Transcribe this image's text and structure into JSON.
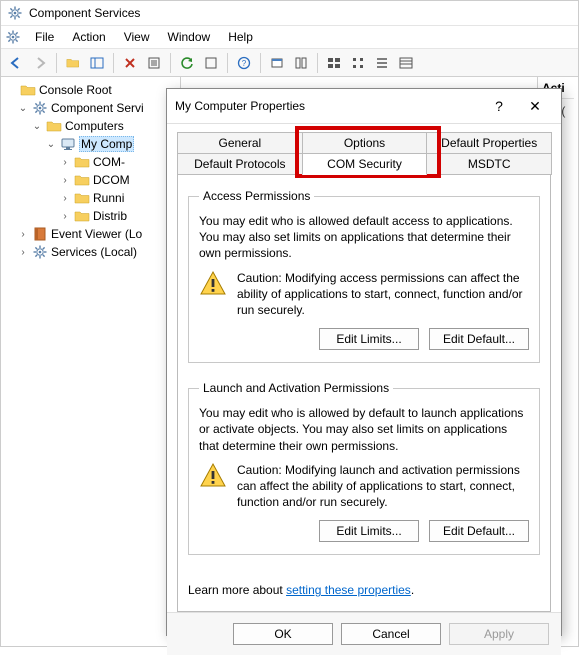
{
  "window": {
    "title": "Component Services"
  },
  "menu": {
    "file": "File",
    "action": "Action",
    "view": "View",
    "window": "Window",
    "help": "Help"
  },
  "tree": {
    "root": "Console Root",
    "n1": "Component Servi",
    "n2": "Computers",
    "n3": "My Comp",
    "n3a": "COM-",
    "n3b": "DCOM",
    "n3c": "Runni",
    "n3d": "Distrib",
    "n4": "Event Viewer (Lo",
    "n5": "Services (Local)"
  },
  "actions": {
    "header": "Acti",
    "row1": "My ("
  },
  "dialog": {
    "title": "My Computer Properties",
    "tabs": {
      "general": "General",
      "options": "Options",
      "defprops": "Default Properties",
      "defproto": "Default Protocols",
      "comsec": "COM Security",
      "msdtc": "MSDTC"
    },
    "access": {
      "legend": "Access Permissions",
      "text": "You may edit who is allowed default access to applications. You may also set limits on applications that determine their own permissions.",
      "caution": "Caution: Modifying access permissions can affect the ability of applications to start, connect, function and/or run securely.",
      "btn_limits": "Edit Limits...",
      "btn_default": "Edit Default..."
    },
    "launch": {
      "legend": "Launch and Activation Permissions",
      "text": "You may edit who is allowed by default to launch applications or activate objects. You may also set limits on applications that determine their own permissions.",
      "caution": "Caution: Modifying launch and activation permissions can affect the ability of applications to start, connect, function and/or run securely.",
      "btn_limits": "Edit Limits...",
      "btn_default": "Edit Default..."
    },
    "learn_prefix": "Learn more about ",
    "learn_link": "setting these properties",
    "ok": "OK",
    "cancel": "Cancel",
    "apply": "Apply"
  }
}
